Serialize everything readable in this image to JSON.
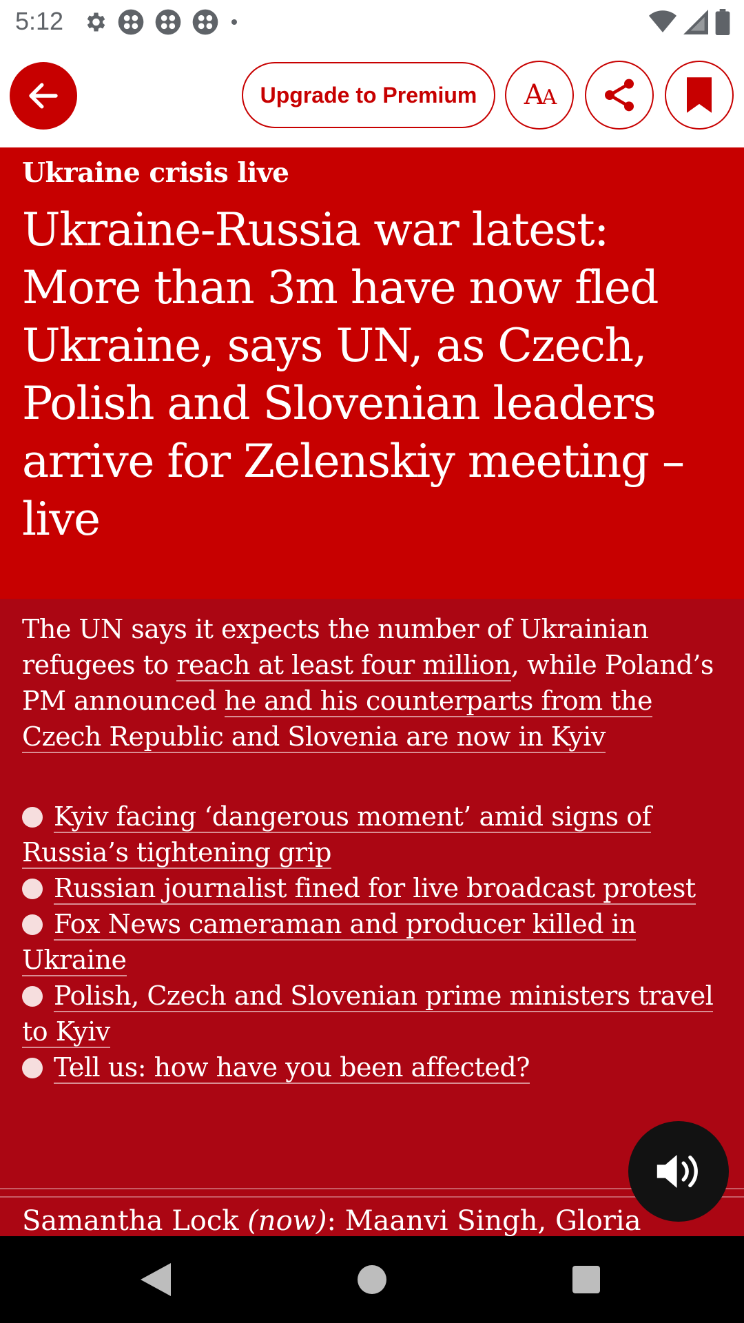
{
  "status_bar": {
    "time": "5:12",
    "icons_left": [
      "gear-icon",
      "app-icon",
      "app-icon",
      "app-icon",
      "dot-icon"
    ],
    "icons_right": [
      "wifi-icon",
      "signal-icon",
      "battery-icon"
    ]
  },
  "toolbar": {
    "upgrade_label": "Upgrade to Premium",
    "text_size_label": "AA"
  },
  "article": {
    "kicker": "Ukraine crisis live",
    "headline": "Ukraine-Russia war latest: More than 3m have now fled Ukraine, says UN, as Czech, Polish and Slovenian leaders arrive for Zelenskiy meeting – live",
    "standfirst": {
      "part1": "The UN says it expects the number of Ukrainian refugees to ",
      "link1": "reach at least four million",
      "part2": ", while Poland’s PM announced ",
      "link2": "he and his counterparts from the Czech Republic and Slovenia are now in Kyiv"
    },
    "bullets": [
      "Kyiv facing ‘dangerous moment’ amid signs of Russia’s tightening grip",
      "Russian journalist fined for live broadcast protest",
      "Fox News cameraman and producer killed in Ukraine",
      "Polish, Czech and Slovenian prime ministers travel to Kyiv",
      "Tell us: how have you been affected?"
    ],
    "byline": {
      "name1": "Samantha Lock",
      "tag": "(now)",
      "rest": ": Maanvi Singh, Gloria"
    }
  },
  "colors": {
    "brand_red": "#c70000",
    "standfirst_red": "#ab0613",
    "audio_button": "#121212"
  }
}
